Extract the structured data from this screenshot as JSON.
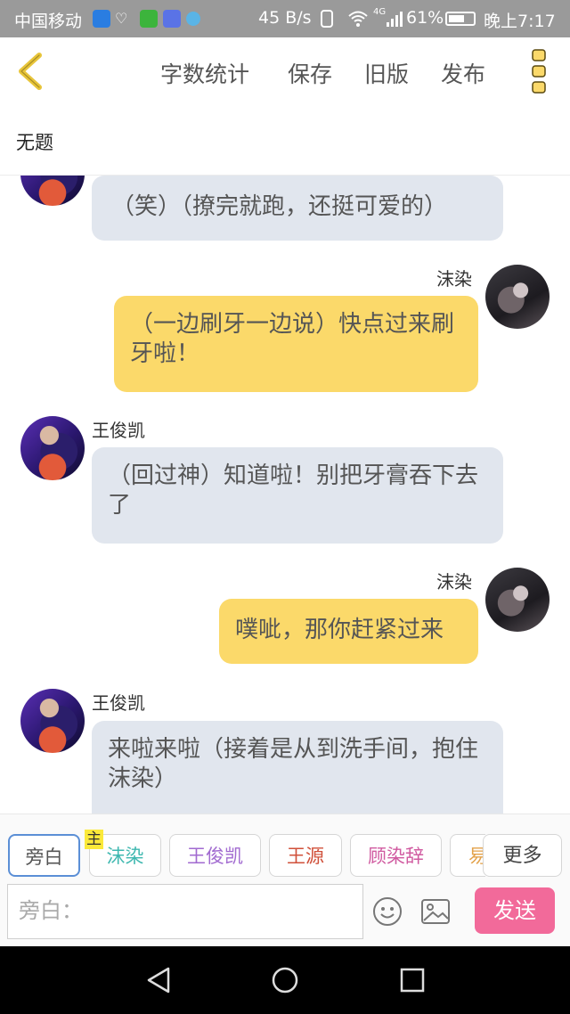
{
  "status_bar": {
    "carrier": "中国移动",
    "speed": "45 B/s",
    "network": "4G",
    "battery": "61%",
    "time": "晚上7:17"
  },
  "topbar": {
    "back_icon": "chevron-left-icon",
    "word_count": "字数统计",
    "save": "保存",
    "old_version": "旧版",
    "publish": "发布",
    "more_icon": "vertical-dots-icon"
  },
  "title": "无题",
  "messages": [
    {
      "side": "left",
      "speaker": "",
      "avatar": "wang-junkai",
      "text": "（笑）（撩完就跑，还挺可爱的）"
    },
    {
      "side": "right",
      "speaker": "沫染",
      "avatar": "mo-ran",
      "text": "（一边刷牙一边说）快点过来刷牙啦！"
    },
    {
      "side": "left",
      "speaker": "王俊凯",
      "avatar": "wang-junkai",
      "text": "（回过神）知道啦！别把牙膏吞下去了"
    },
    {
      "side": "right",
      "speaker": "沫染",
      "avatar": "mo-ran",
      "text": "噗呲，那你赶紧过来"
    },
    {
      "side": "left",
      "speaker": "王俊凯",
      "avatar": "wang-junkai",
      "text": "来啦来啦（接着是从到洗手间，抱住沫染）"
    }
  ],
  "roles": {
    "narrator": "旁白",
    "main_badge": "主",
    "items": [
      {
        "label": "沫染",
        "color": "#3fb8b0"
      },
      {
        "label": "王俊凯",
        "color": "#a16ad0"
      },
      {
        "label": "王源",
        "color": "#d0503a"
      },
      {
        "label": "顾染辞",
        "color": "#d05aa0"
      },
      {
        "label": "易",
        "color": "#e3a24a"
      }
    ],
    "more": "更多"
  },
  "input": {
    "placeholder": "旁白：",
    "emoji_icon": "smiley-icon",
    "image_icon": "image-icon",
    "send": "发送"
  },
  "colors": {
    "accent_yellow": "#fbd96a",
    "left_bubble": "#e1e6ee",
    "send_pink": "#f26a9a",
    "back_yellow": "#e8c53a"
  }
}
